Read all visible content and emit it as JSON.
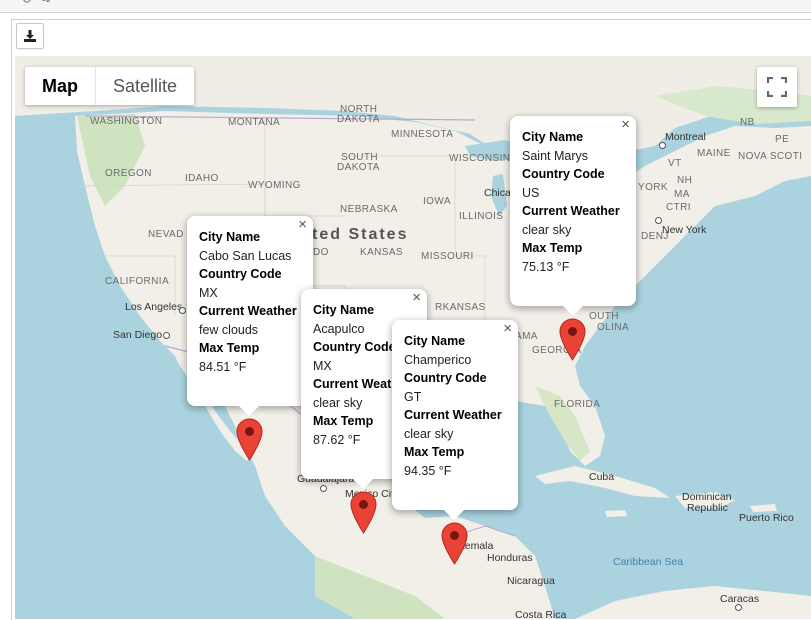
{
  "toolbar": {
    "download_label": "Download"
  },
  "map_type": {
    "map": "Map",
    "satellite": "Satellite",
    "selected": "Map"
  },
  "labels": {
    "washington": "WASHINGTON",
    "montana": "MONTANA",
    "north_dakota_1": "NORTH",
    "north_dakota_2": "DAKOTA",
    "minnesota": "MINNESOTA",
    "south_dakota_1": "SOUTH",
    "south_dakota_2": "DAKOTA",
    "wisconsin": "WISCONSIN",
    "oregon": "OREGON",
    "idaho": "IDAHO",
    "wyoming": "WYOMING",
    "nebraska": "NEBRASKA",
    "iowa": "IOWA",
    "illinois": "ILLINOIS",
    "nevada": "NEVAD",
    "united_states": "ted States",
    "kansas": "KANSAS",
    "missouri": "MISSOURI",
    "california": "CALIFORNIA",
    "arkansas": "RKANSAS",
    "alabama": "AMA",
    "georgia": "GEORGIA",
    "south_carolina": "OUTH",
    "carolina": "OLINA",
    "florida": "FLORIDA",
    "new_york_state": "YORK",
    "vermont": "VT",
    "new_hampshire": "NH",
    "massachusetts": "MA",
    "connecticut": "CTRI",
    "maine": "MAINE",
    "new_brunswick": "NB",
    "nova_scotia": "NOVA SCOTI",
    "pe": "PE",
    "delaware": "DENJ",
    "chicago": "Chica",
    "montreal": "Montreal",
    "new_york_city": "New York",
    "los_angeles": "Los Angeles",
    "san_diego": "San Diego",
    "do": "DO",
    "cuba": "Cuba",
    "dominican_1": "Dominican",
    "dominican_2": "Republic",
    "puerto_rico": "Puerto Rico",
    "caribbean": "Caribbean Sea",
    "honduras": "Honduras",
    "guatemala": "atemala",
    "nicaragua": "Nicaragua",
    "costa_rica": "Costa Rica",
    "caracas": "Caracas",
    "guadalajara": "Guadalajara",
    "mexico_city": "Mexico City"
  },
  "popups": [
    {
      "city_key": "City Name",
      "city": "Cabo San Lucas",
      "country_key": "Country Code",
      "country": "MX",
      "weather_key": "Current Weather",
      "weather": "few clouds",
      "temp_key": "Max Temp",
      "temp": "84.51 °F"
    },
    {
      "city_key": "City Name",
      "city": "Acapulco",
      "country_key": "Country Code",
      "country": "MX",
      "weather_key": "Current Weath",
      "weather": "clear sky",
      "temp_key": "Max Temp",
      "temp": "87.62 °F"
    },
    {
      "city_key": "City Name",
      "city": "Champerico",
      "country_key": "Country Code",
      "country": "GT",
      "weather_key": "Current Weather",
      "weather": "clear sky",
      "temp_key": "Max Temp",
      "temp": "94.35 °F"
    },
    {
      "city_key": "City Name",
      "city": "Saint Marys",
      "country_key": "Country Code",
      "country": "US",
      "weather_key": "Current Weather",
      "weather": "clear sky",
      "temp_key": "Max Temp",
      "temp": "75.13 °F"
    }
  ],
  "colors": {
    "water": "#aad3df",
    "land": "#f2efe9",
    "green": "#cfe3c0",
    "marker": "#ea4335",
    "border": "#b9a9c9"
  },
  "icons": {
    "download": "download-icon",
    "fullscreen": "fullscreen-icon",
    "close": "close-icon",
    "marker": "map-marker-icon"
  }
}
